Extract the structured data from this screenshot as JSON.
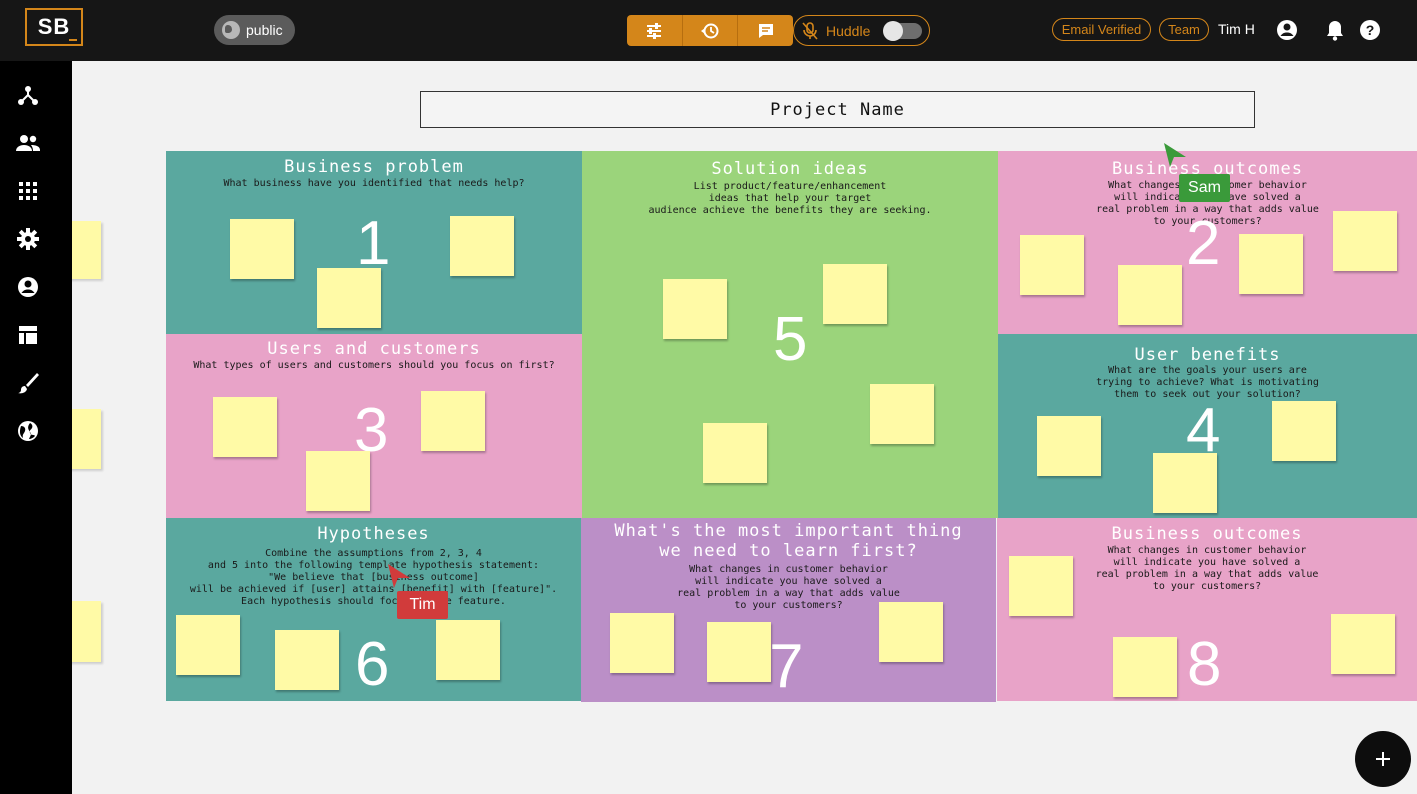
{
  "header": {
    "logo": "SB",
    "visibility_label": "public",
    "huddle_label": "Huddle",
    "email_verified": "Email Verified",
    "team": "Team",
    "user_name": "Tim H"
  },
  "canvas": {
    "project_name": "Project Name"
  },
  "panels": [
    {
      "title": "Business problem",
      "desc": "What business have you identified that needs help?",
      "number": "1"
    },
    {
      "title": "Solution ideas",
      "desc": "List product/feature/enhancement\nideas that help your target\naudience achieve the benefits they are seeking.",
      "number": "5"
    },
    {
      "title": "Business outcomes",
      "desc": "What changes in customer behavior\nwill indicate you have solved a\nreal problem in a way that adds value\nto your customers?",
      "number": "2"
    },
    {
      "title": "Users and customers",
      "desc": "What types of users and customers should you focus on first?",
      "number": "3"
    },
    {
      "title": "User benefits",
      "desc": "What are the goals your users are\ntrying to achieve? What is motivating\nthem to seek out your solution?",
      "number": "4"
    },
    {
      "title": "Hypotheses",
      "desc": "Combine the assumptions from 2, 3, 4\nand 5 into the following template hypothesis statement:\n\"We believe that [business outcome]\nwill be achieved if [user] attains [benefit] with [feature]\".\nEach hypothesis should focus on one feature.",
      "number": "6"
    },
    {
      "title": "What's the most important thing\nwe need to learn first?",
      "desc": "What changes in customer behavior\nwill indicate you have solved a\nreal problem in a way that adds value\nto your customers?",
      "number": "7"
    },
    {
      "title": "Business outcomes",
      "desc": "What changes in customer behavior\nwill indicate you have solved a\nreal problem in a way that adds value\nto your customers?",
      "number": "8"
    }
  ],
  "cursors": [
    {
      "name": "Sam",
      "color": "#3a9a3a"
    },
    {
      "name": "Tim",
      "color": "#d13b3b"
    }
  ],
  "colors": {
    "accent": "#d4861a",
    "teal": "#5aa89f",
    "pink": "#e8a3c8",
    "green": "#9bd47b",
    "purple": "#bb8fc7",
    "sticky": "#fffaa6"
  },
  "icons": {
    "sidebar": [
      "hierarchy-icon",
      "users-icon",
      "grid-icon",
      "gear-icon",
      "account-circle-icon",
      "table-icon",
      "brush-icon",
      "globe-icon"
    ],
    "toolbar": [
      "sliders-icon",
      "history-icon",
      "chat-icon",
      "mic-off-icon"
    ]
  }
}
